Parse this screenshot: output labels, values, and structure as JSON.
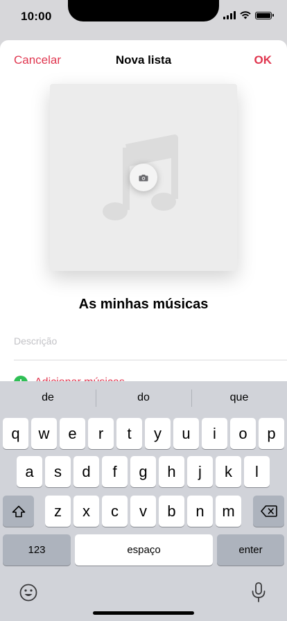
{
  "status": {
    "time": "10:00"
  },
  "nav": {
    "cancel": "Cancelar",
    "title": "Nova lista",
    "ok": "OK"
  },
  "playlist": {
    "name": "As minhas músicas",
    "description_placeholder": "Descrição",
    "add_music": "Adicionar músicas"
  },
  "keyboard": {
    "suggestions": [
      "de",
      "do",
      "que"
    ],
    "row1": [
      "q",
      "w",
      "e",
      "r",
      "t",
      "y",
      "u",
      "i",
      "o",
      "p"
    ],
    "row2": [
      "a",
      "s",
      "d",
      "f",
      "g",
      "h",
      "j",
      "k",
      "l"
    ],
    "row3": [
      "z",
      "x",
      "c",
      "v",
      "b",
      "n",
      "m"
    ],
    "numbers_key": "123",
    "space_key": "espaço",
    "enter_key": "enter"
  },
  "icons": {
    "music_note": "music-note-icon",
    "camera": "camera-icon",
    "shift": "shift-icon",
    "delete": "delete-icon",
    "emoji": "emoji-icon",
    "mic": "microphone-icon"
  },
  "colors": {
    "accent": "#e0364f",
    "add_green": "#2fbf55",
    "keyboard_bg": "#d1d3d9"
  }
}
